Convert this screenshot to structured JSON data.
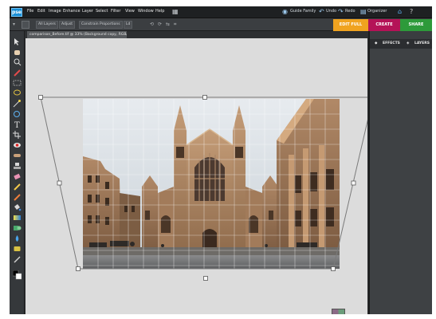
{
  "app": {
    "logo_text": "pse"
  },
  "menu": {
    "items": [
      "File",
      "Edit",
      "Image",
      "Enhance",
      "Layer",
      "Select",
      "Filter",
      "View",
      "Window",
      "Help"
    ],
    "right": {
      "search": "Guide Family",
      "undo": "Undo",
      "redo": "Redo",
      "organizer": "Organizer"
    }
  },
  "modes": {
    "edit": "EDIT FULL",
    "create": "CREATE",
    "share": "SHARE"
  },
  "options": {
    "all_layers": "All Layers",
    "adjust": "Adjust",
    "constrain": "Constrain Proportions",
    "reference": "Ld"
  },
  "document": {
    "tab_title": "comparison_Before.tif @ 33% (Background copy, RGB/8) *"
  },
  "panels": {
    "effects_tab": "EFFECTS",
    "layers_tab": "LAYERS"
  },
  "colors": {
    "accent_edit": "#f0a320",
    "accent_create": "#b41357",
    "accent_share": "#2d9a3a",
    "canvas_bg": "#dcdcdc"
  },
  "icons": [
    "home-icon",
    "help-icon",
    "move-tool-icon",
    "hand-tool-icon",
    "zoom-tool-icon",
    "eyedropper-icon",
    "marquee-icon",
    "lasso-icon",
    "magic-wand-icon",
    "quick-selection-icon",
    "type-tool-icon",
    "crop-tool-icon",
    "red-eye-icon",
    "healing-brush-icon",
    "clone-stamp-icon",
    "eraser-icon",
    "brush-icon",
    "smart-brush-icon",
    "paint-bucket-icon",
    "gradient-icon",
    "shape-tool-icon",
    "blur-tool-icon",
    "sponge-tool-icon",
    "pencil-icon",
    "color-swatches-icon"
  ]
}
